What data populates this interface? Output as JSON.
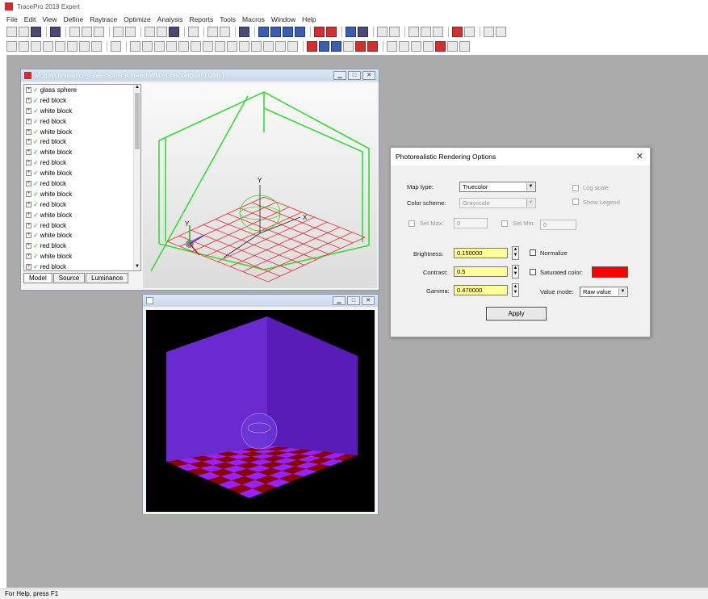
{
  "app": {
    "title": "TracePro 2019 Expert"
  },
  "menubar": {
    "items": [
      "File",
      "Edit",
      "View",
      "Define",
      "Raytrace",
      "Optimize",
      "Analysis",
      "Reports",
      "Tools",
      "Macros",
      "Window",
      "Help"
    ]
  },
  "model_window": {
    "title": "Model[Luminance_GlassSphereOnRed-WhiteCheckerboard.OML]",
    "tree_items": [
      "glass sphere",
      "red block",
      "white block",
      "red block",
      "white block",
      "red block",
      "white block",
      "red block",
      "white block",
      "red block",
      "white block",
      "red block",
      "white block",
      "red block",
      "white block",
      "red block",
      "white block",
      "red block"
    ],
    "tabs": [
      "Model",
      "Source",
      "Luminance"
    ],
    "axis_labels": {
      "y": "Y",
      "x": "X"
    }
  },
  "render_window": {
    "title": ""
  },
  "dialog": {
    "title": "Photorealistic Rendering Options",
    "map_type_label": "Map type:",
    "map_type_value": "Truecolor",
    "color_scheme_label": "Color scheme:",
    "color_scheme_value": "Grayscale",
    "log_scale_label": "Log scale",
    "show_legend_label": "Show Legend",
    "set_max_label": "Set Max:",
    "set_max_value": "0",
    "set_min_label": "Set Min:",
    "set_min_value": "0",
    "brightness_label": "Brightness:",
    "brightness_value": "0.150000",
    "contrast_label": "Contrast:",
    "contrast_value": "0.5",
    "gamma_label": "Gamma:",
    "gamma_value": "0.470000",
    "normalize_label": "Normalize",
    "saturated_color_label": "Saturated color:",
    "saturated_color": "#ff0000",
    "value_mode_label": "Value mode:",
    "value_mode_value": "Raw value",
    "apply_label": "Apply"
  },
  "statusbar": {
    "text": "For Help, press F1"
  },
  "colors": {
    "mdi_background": "#ababab",
    "wire_green": "#33dd33",
    "wire_red": "#ee3333",
    "render_wall": "#7a30e0",
    "checker_red": "#8a0000",
    "checker_violet": "#9a20ff"
  }
}
